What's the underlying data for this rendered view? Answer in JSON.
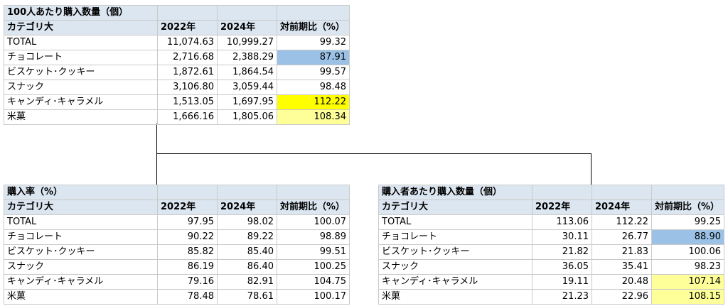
{
  "tables": [
    {
      "title": "100人あたり購入数量（個）",
      "headers": [
        "カテゴリ大",
        "2022年",
        "2024年",
        "対前期比（%）"
      ],
      "rows": [
        {
          "name": "TOTAL",
          "y2022": "11,074.63",
          "y2024": "10,999.27",
          "ratio": "99.32",
          "highlight": ""
        },
        {
          "name": "チョコレート",
          "y2022": "2,716.68",
          "y2024": "2,388.29",
          "ratio": "87.91",
          "highlight": "blue"
        },
        {
          "name": "ビスケット･クッキー",
          "y2022": "1,872.61",
          "y2024": "1,864.54",
          "ratio": "99.57",
          "highlight": ""
        },
        {
          "name": "スナック",
          "y2022": "3,106.80",
          "y2024": "3,059.44",
          "ratio": "98.48",
          "highlight": ""
        },
        {
          "name": "キャンディ･キャラメル",
          "y2022": "1,513.05",
          "y2024": "1,697.95",
          "ratio": "112.22",
          "highlight": "yellow"
        },
        {
          "name": "米菓",
          "y2022": "1,666.16",
          "y2024": "1,805.06",
          "ratio": "108.34",
          "highlight": "lightyellow"
        }
      ]
    },
    {
      "title": "購入率（%）",
      "headers": [
        "カテゴリ大",
        "2022年",
        "2024年",
        "対前期比（%）"
      ],
      "rows": [
        {
          "name": "TOTAL",
          "y2022": "97.95",
          "y2024": "98.02",
          "ratio": "100.07",
          "highlight": ""
        },
        {
          "name": "チョコレート",
          "y2022": "90.22",
          "y2024": "89.22",
          "ratio": "98.89",
          "highlight": ""
        },
        {
          "name": "ビスケット･クッキー",
          "y2022": "85.82",
          "y2024": "85.40",
          "ratio": "99.51",
          "highlight": ""
        },
        {
          "name": "スナック",
          "y2022": "86.19",
          "y2024": "86.40",
          "ratio": "100.25",
          "highlight": ""
        },
        {
          "name": "キャンディ･キャラメル",
          "y2022": "79.16",
          "y2024": "82.91",
          "ratio": "104.75",
          "highlight": ""
        },
        {
          "name": "米菓",
          "y2022": "78.48",
          "y2024": "78.61",
          "ratio": "100.17",
          "highlight": ""
        }
      ]
    },
    {
      "title": "購入者あたり購入数量（個）",
      "headers": [
        "カテゴリ大",
        "2022年",
        "2024年",
        "対前期比（%）"
      ],
      "rows": [
        {
          "name": "TOTAL",
          "y2022": "113.06",
          "y2024": "112.22",
          "ratio": "99.25",
          "highlight": ""
        },
        {
          "name": "チョコレート",
          "y2022": "30.11",
          "y2024": "26.77",
          "ratio": "88.90",
          "highlight": "blue"
        },
        {
          "name": "ビスケット･クッキー",
          "y2022": "21.82",
          "y2024": "21.83",
          "ratio": "100.06",
          "highlight": ""
        },
        {
          "name": "スナック",
          "y2022": "36.05",
          "y2024": "35.41",
          "ratio": "98.23",
          "highlight": ""
        },
        {
          "name": "キャンディ･キャラメル",
          "y2022": "19.11",
          "y2024": "20.48",
          "ratio": "107.14",
          "highlight": "lightyellow"
        },
        {
          "name": "米菓",
          "y2022": "21.23",
          "y2024": "22.96",
          "ratio": "108.15",
          "highlight": "lightyellow"
        }
      ]
    }
  ],
  "colors": {
    "header_bg": "#dce6f1",
    "blue": "#9bc2e6",
    "yellow": "#ffff00",
    "lightyellow": "#ffff99",
    "grid": "#c9c9c9"
  }
}
